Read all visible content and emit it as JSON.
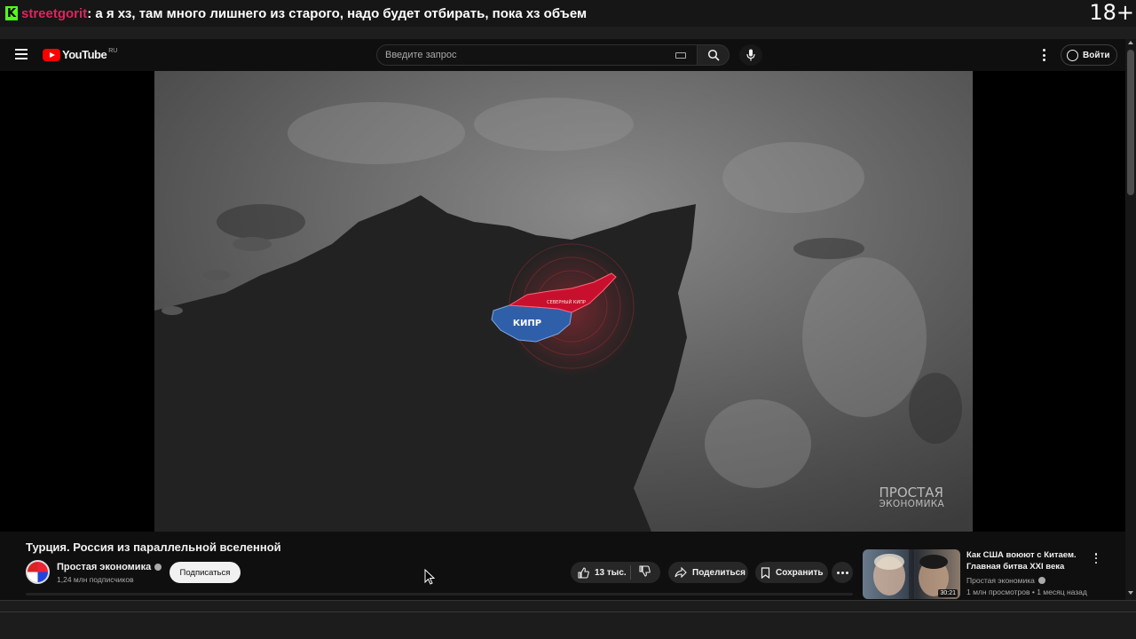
{
  "overlay": {
    "chat_username": "streetgorit",
    "chat_message": ": а я хз, там много лишнего из старого, надо будет отбирать, пока хз объем",
    "age_rating": "18+"
  },
  "header": {
    "logo_text": "YouTube",
    "region": "RU",
    "search_placeholder": "Введите запрос",
    "signin_label": "Войти"
  },
  "video": {
    "map_labels": {
      "cyprus": "КИПР",
      "northern_cyprus": "СЕВЕРНЫЙ КИПР"
    },
    "watermark_line1": "ПРОСТАЯ",
    "watermark_line2": "ЭКОНОМИКА",
    "title": "Турция. Россия из параллельной вселенной"
  },
  "channel": {
    "name": "Простая экономика",
    "subscribers": "1,24 млн подписчиков",
    "subscribe_label": "Подписаться"
  },
  "actions": {
    "likes": "13 тыс.",
    "share_label": "Поделиться",
    "save_label": "Сохранить"
  },
  "recommendation": {
    "title": "Как США воюют с Китаем. Главная битва XXI века",
    "channel": "Простая экономика",
    "meta": "1 млн просмотров • 1 месяц назад",
    "duration": "30:21"
  },
  "colors": {
    "chat_username": "#e0245e",
    "kick_green": "#53fc18",
    "youtube_red": "#ff0000",
    "northern_cyprus": "#c8102e",
    "cyprus": "#2f5fa8"
  }
}
